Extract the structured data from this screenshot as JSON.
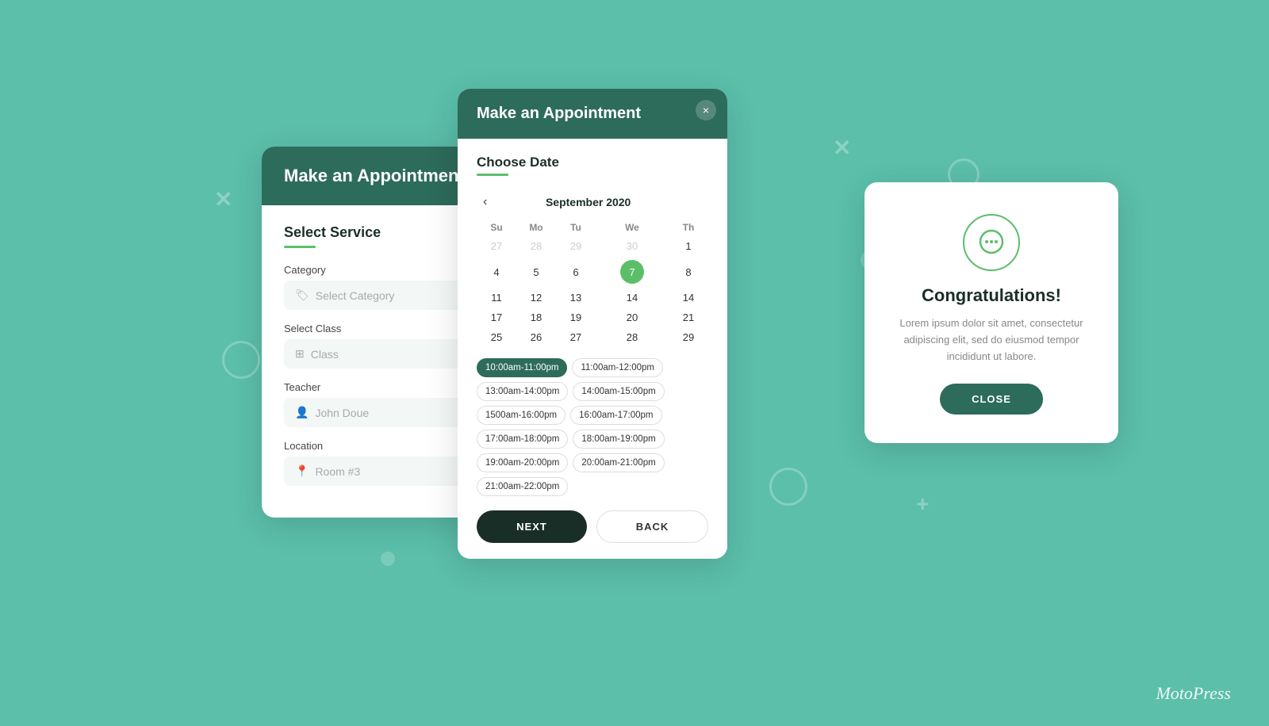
{
  "background_color": "#5bbfaa",
  "brand": "MotoPress",
  "card_select_service": {
    "header_title": "Make an Appointment",
    "section_title": "Select Service",
    "fields": [
      {
        "label": "Category",
        "placeholder": "Select Category",
        "icon": "tag"
      },
      {
        "label": "Select Class",
        "placeholder": "Class",
        "icon": "grid"
      },
      {
        "label": "Teacher",
        "placeholder": "John Doue",
        "icon": "person"
      },
      {
        "label": "Location",
        "placeholder": "Room #3",
        "icon": "pin"
      }
    ]
  },
  "card_calendar": {
    "header_title": "Make an Appointment",
    "close_label": "×",
    "choose_date_label": "Choose Date",
    "month": "September 2020",
    "days_of_week": [
      "Su",
      "Mo",
      "Tu",
      "We",
      "Th"
    ],
    "weeks": [
      [
        "27",
        "28",
        "29",
        "30",
        "1"
      ],
      [
        "4",
        "5",
        "6",
        "7",
        "8"
      ],
      [
        "11",
        "12",
        "13",
        "14",
        "14"
      ],
      [
        "17",
        "18",
        "19",
        "20",
        "21"
      ],
      [
        "25",
        "26",
        "27",
        "28",
        "29"
      ]
    ],
    "inactive_days": [
      "27",
      "28",
      "29",
      "30"
    ],
    "selected_day": "7",
    "time_slots": [
      {
        "label": "10:00am-11:00pm",
        "active": true
      },
      {
        "label": "11:00am-12:00pm",
        "active": false
      },
      {
        "label": "13:00am-14:00pm",
        "active": false
      },
      {
        "label": "14:00am-15:00pm",
        "active": false
      },
      {
        "label": "1500am-16:00pm",
        "active": false
      },
      {
        "label": "16:00am-17:00pm",
        "active": false
      },
      {
        "label": "17:00am-18:00pm",
        "active": false
      },
      {
        "label": "18:00am-19:00pm",
        "active": false
      },
      {
        "label": "19:00am-20:00pm",
        "active": false
      },
      {
        "label": "20:00am-21:00pm",
        "active": false
      },
      {
        "label": "21:00am-22:00pm",
        "active": false
      }
    ],
    "btn_next": "NEXT",
    "btn_back": "BACK"
  },
  "card_congrats": {
    "icon": "chat-bubble",
    "title": "Congratulations!",
    "body_text": "Lorem ipsum dolor sit amet, consectetur adipiscing elit, sed do eiusmod tempor incididunt ut labore.",
    "btn_close_label": "CLOSE"
  }
}
